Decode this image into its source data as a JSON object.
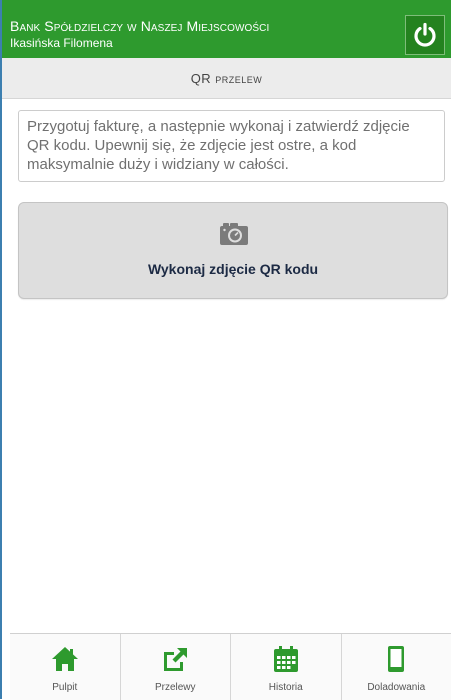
{
  "header": {
    "bank_name": "Bank Spółdzielczy w Naszej Miejscowości",
    "user_name": "Ikasińska Filomena",
    "logout_icon": "power-icon"
  },
  "page": {
    "title": "QR przelew"
  },
  "instructions": {
    "text": "Przygotuj fakturę, a następnie wykonaj i zatwierdź zdjęcie QR kodu. Upewnij się, że zdjęcie jest ostre, a kod maksymalnie duży i widziany w całości."
  },
  "capture": {
    "icon": "camera-icon",
    "label": "Wykonaj zdjęcie QR kodu"
  },
  "nav": {
    "items": [
      {
        "label": "Pulpit",
        "icon": "home-icon"
      },
      {
        "label": "Przelewy",
        "icon": "share-icon"
      },
      {
        "label": "Historia",
        "icon": "calendar-icon"
      },
      {
        "label": "Doladowania",
        "icon": "mobile-icon"
      }
    ]
  },
  "colors": {
    "brand_green": "#2e9a2e",
    "icon_green": "#2e9a2e"
  }
}
